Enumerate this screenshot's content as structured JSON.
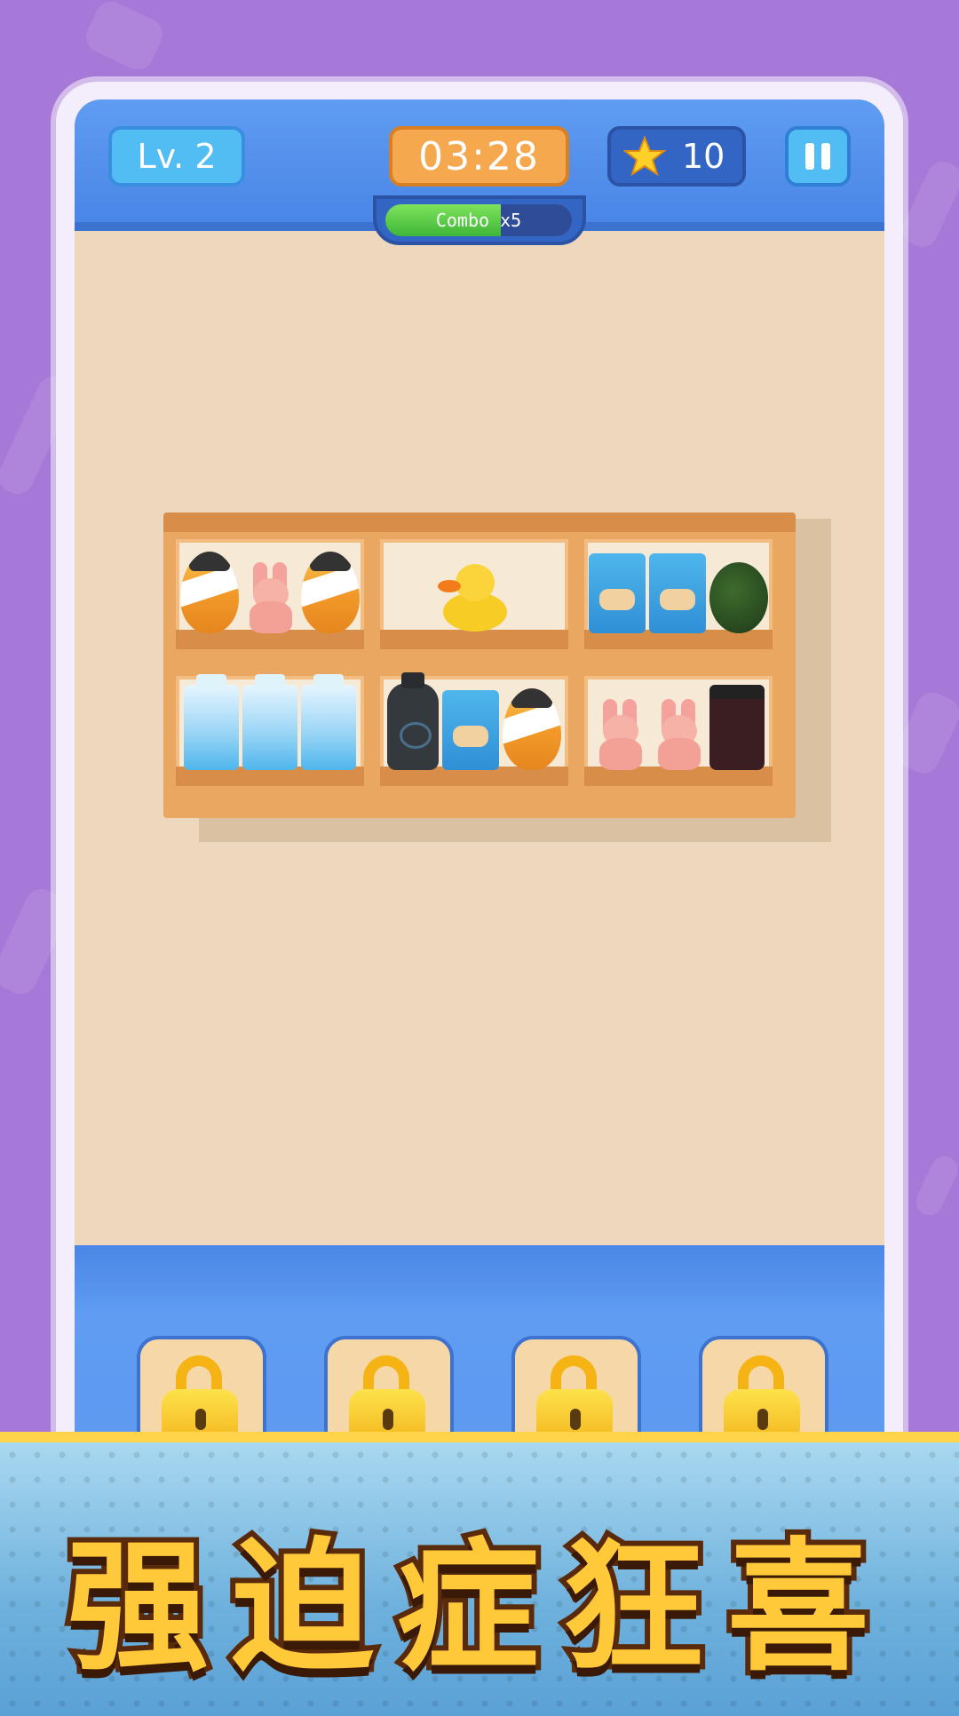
{
  "hud": {
    "level": "Lv. 2",
    "timer": "03:28",
    "stars": "10",
    "combo": "Combo x5",
    "combo_progress": 0.62
  },
  "shelf": {
    "cells": [
      [
        "egg",
        "bunny",
        "egg"
      ],
      [
        "duck"
      ],
      [
        "chips",
        "chips",
        "cabbage"
      ],
      [
        "milk",
        "milk",
        "milk"
      ],
      [
        "bottle",
        "chips",
        "egg"
      ],
      [
        "bunny",
        "bunny",
        "jar"
      ]
    ]
  },
  "tray": {
    "slots": [
      "locked",
      "locked",
      "locked",
      "locked"
    ]
  },
  "banner": {
    "title": "强迫症狂喜"
  },
  "colors": {
    "background": "#a678d8",
    "header": "#4a86e6",
    "accent": "#f6a84e"
  }
}
